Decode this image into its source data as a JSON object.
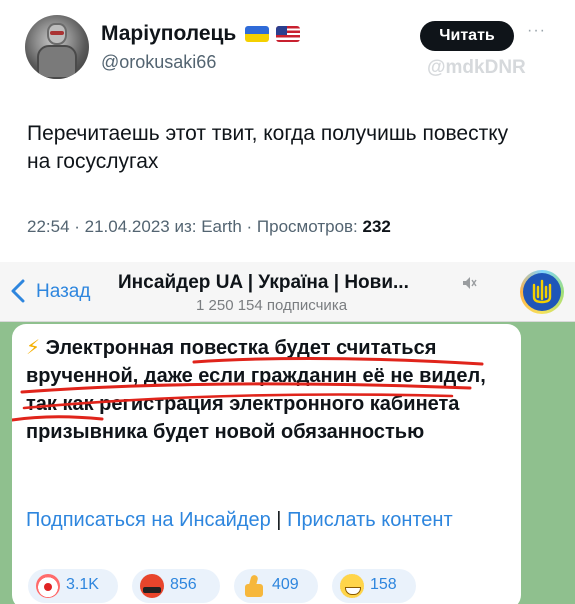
{
  "tweet": {
    "display_name": "Маріуполець",
    "handle": "@orokusaki66",
    "follow_label": "Читать",
    "more_label": "···",
    "watermark": "@mdkDNR",
    "text": "Перечитаешь этот твит, когда получишь повестку на госуслугах",
    "meta_prefix": "22:54 · 21.04.2023 из: Earth · Просмотров: ",
    "views": "232",
    "flags": [
      "flag-ukraine-icon",
      "flag-usa-icon"
    ]
  },
  "telegram": {
    "back_label": "Назад",
    "channel_title": "Инсайдер UA | Україна | Нови...",
    "subscribers": "1 250 154 подписчика",
    "message_bolt": "⚡",
    "message_text": " Электронная повестка будет считаться врученной, даже если гражданин её не видел, так как регистрация электронного кабинета призывника будет новой обязанностью",
    "link_subscribe": "Подписаться на Инсайдер",
    "link_separator": " | ",
    "link_send": "Прислать контент",
    "reactions": [
      {
        "icon": "clown-face-icon",
        "count": "3.1K"
      },
      {
        "icon": "angry-face-icon",
        "count": "856"
      },
      {
        "icon": "thumbs-up-icon",
        "count": "409"
      },
      {
        "icon": "grinning-face-icon",
        "count": "158"
      }
    ],
    "colors": {
      "accent": "#2e86de",
      "chat_background": "#8fc08e",
      "highlight_stroke": "#e0241b"
    }
  }
}
